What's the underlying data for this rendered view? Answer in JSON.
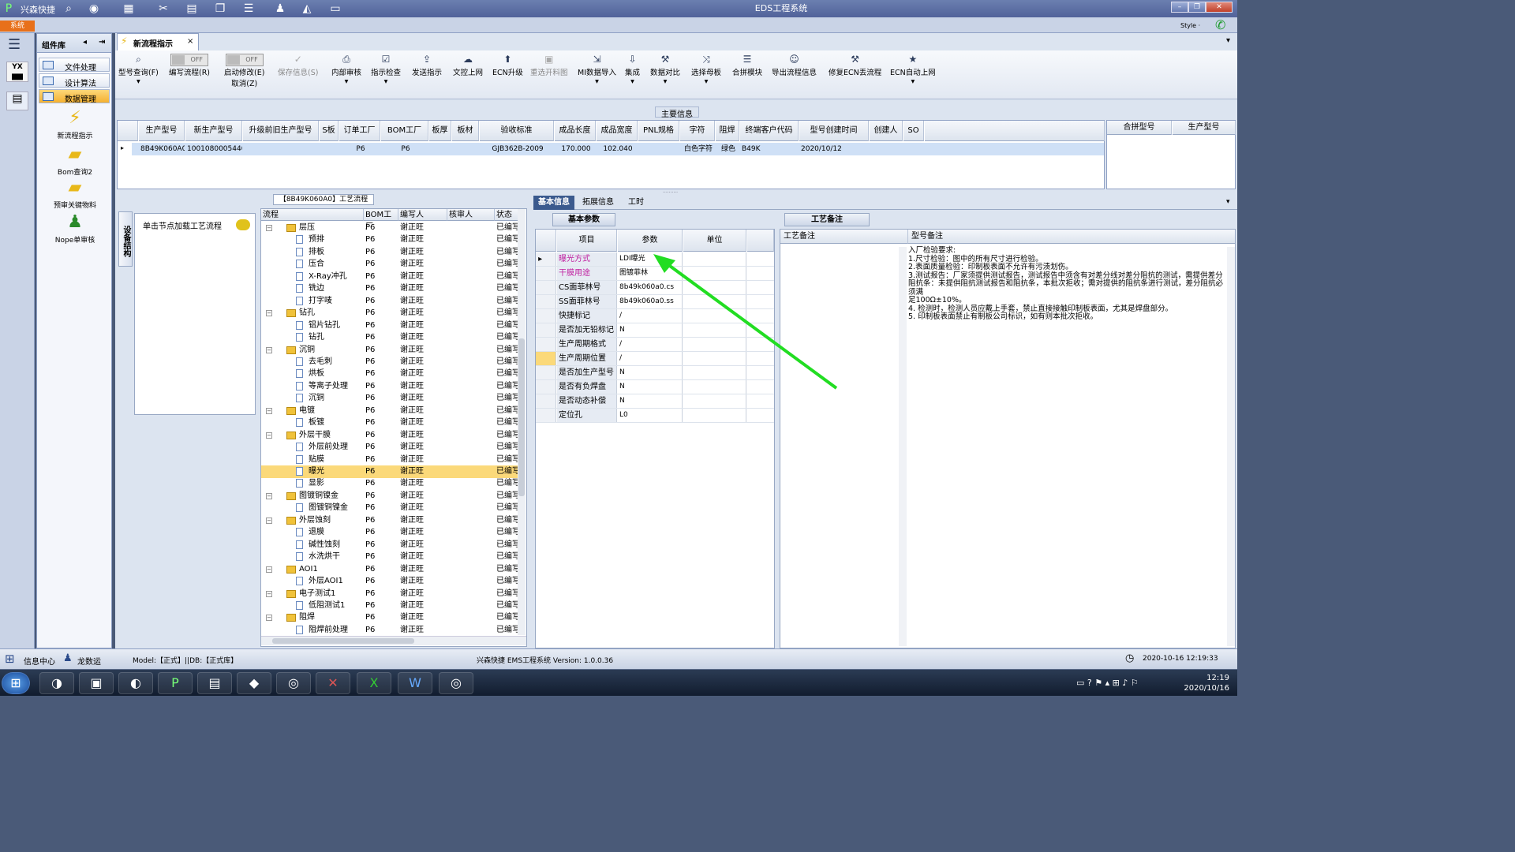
{
  "app": {
    "name": "兴森快捷",
    "window_title": "EDS工程系统",
    "style_label": "Style ·",
    "sys_tab": "系统"
  },
  "left_panel": {
    "header": "组件库",
    "items": [
      {
        "label": "文件处理"
      },
      {
        "label": "设计算法"
      },
      {
        "label": "数据管理"
      }
    ],
    "tools": [
      {
        "label": "新流程指示"
      },
      {
        "label": "Bom查询2"
      },
      {
        "label": "预审关键物料"
      },
      {
        "label": "Nope单审核"
      }
    ]
  },
  "doc_tab": {
    "label": "新流程指示"
  },
  "ribbon": {
    "buttons": [
      {
        "label": "型号查询(F)"
      },
      {
        "label": "编写流程(R)",
        "toggle": "OFF"
      },
      {
        "label": "启动修改(E)",
        "toggle": "OFF",
        "sub": "取消(Z)"
      },
      {
        "label": "保存信息(S)"
      },
      {
        "label": "内部审核"
      },
      {
        "label": "指示检查"
      },
      {
        "label": "发送指示"
      },
      {
        "label": "文控上网"
      },
      {
        "label": "ECN升级"
      },
      {
        "label": "重选开料图"
      },
      {
        "label": "MI数据导入"
      },
      {
        "label": "集成"
      },
      {
        "label": "数据对比"
      },
      {
        "label": "选择母板"
      },
      {
        "label": "合拼模块"
      },
      {
        "label": "导出流程信息"
      },
      {
        "label": "修复ECN丢流程"
      },
      {
        "label": "ECN自动上网"
      }
    ]
  },
  "main_info": {
    "title": "主要信息",
    "columns": [
      "生产型号",
      "新生产型号",
      "升级前旧生产型号",
      "S板",
      "订单工厂",
      "BOM工厂",
      "板厚",
      "板材",
      "验收标准",
      "成品长度",
      "成品宽度",
      "PNL规格",
      "字符",
      "阻焊",
      "终端客户代码",
      "型号创建时间",
      "创建人",
      "SO"
    ],
    "row": [
      "8B49K060A0",
      "10010800054405",
      "",
      "",
      "P6",
      "P6",
      "",
      "",
      "GJB362B-2009",
      "170.000",
      "102.040",
      "",
      "白色字符",
      "绿色",
      "B49K",
      "2020/10/12",
      "",
      ""
    ],
    "right_columns": [
      "合拼型号",
      "生产型号"
    ]
  },
  "flow": {
    "title": "【8B49K060A0】工艺流程",
    "side_tab": "设备结构",
    "load_hint": "单击节点加载工艺流程",
    "columns": [
      "流程",
      "BOM工厂",
      "编写人",
      "核审人",
      "状态"
    ],
    "rows": [
      {
        "name": "层压",
        "level": 0,
        "folder": true,
        "factory": "P6",
        "author": "谢正旺",
        "status": "已编写"
      },
      {
        "name": "预排",
        "level": 1,
        "factory": "P6",
        "author": "谢正旺",
        "status": "已编写"
      },
      {
        "name": "排板",
        "level": 1,
        "factory": "P6",
        "author": "谢正旺",
        "status": "已编写"
      },
      {
        "name": "压合",
        "level": 1,
        "factory": "P6",
        "author": "谢正旺",
        "status": "已编写"
      },
      {
        "name": "X-Ray冲孔",
        "level": 1,
        "factory": "P6",
        "author": "谢正旺",
        "status": "已编写"
      },
      {
        "name": "铣边",
        "level": 1,
        "factory": "P6",
        "author": "谢正旺",
        "status": "已编写"
      },
      {
        "name": "打字唛",
        "level": 1,
        "factory": "P6",
        "author": "谢正旺",
        "status": "已编写"
      },
      {
        "name": "钻孔",
        "level": 0,
        "folder": true,
        "factory": "P6",
        "author": "谢正旺",
        "status": "已编写"
      },
      {
        "name": "铝片钻孔",
        "level": 1,
        "factory": "P6",
        "author": "谢正旺",
        "status": "已编写"
      },
      {
        "name": "钻孔",
        "level": 1,
        "factory": "P6",
        "author": "谢正旺",
        "status": "已编写"
      },
      {
        "name": "沉铜",
        "level": 0,
        "folder": true,
        "factory": "P6",
        "author": "谢正旺",
        "status": "已编写"
      },
      {
        "name": "去毛刺",
        "level": 1,
        "factory": "P6",
        "author": "谢正旺",
        "status": "已编写"
      },
      {
        "name": "烘板",
        "level": 1,
        "factory": "P6",
        "author": "谢正旺",
        "status": "已编写"
      },
      {
        "name": "等离子处理",
        "level": 1,
        "factory": "P6",
        "author": "谢正旺",
        "status": "已编写"
      },
      {
        "name": "沉铜",
        "level": 1,
        "factory": "P6",
        "author": "谢正旺",
        "status": "已编写"
      },
      {
        "name": "电镀",
        "level": 0,
        "folder": true,
        "factory": "P6",
        "author": "谢正旺",
        "status": "已编写"
      },
      {
        "name": "板镀",
        "level": 1,
        "factory": "P6",
        "author": "谢正旺",
        "status": "已编写"
      },
      {
        "name": "外层干膜",
        "level": 0,
        "folder": true,
        "factory": "P6",
        "author": "谢正旺",
        "status": "已编写"
      },
      {
        "name": "外层前处理",
        "level": 1,
        "factory": "P6",
        "author": "谢正旺",
        "status": "已编写"
      },
      {
        "name": "贴膜",
        "level": 1,
        "factory": "P6",
        "author": "谢正旺",
        "status": "已编写"
      },
      {
        "name": "曝光",
        "level": 1,
        "factory": "P6",
        "author": "谢正旺",
        "status": "已编写",
        "selected": true
      },
      {
        "name": "显影",
        "level": 1,
        "factory": "P6",
        "author": "谢正旺",
        "status": "已编写"
      },
      {
        "name": "图镀铜镍金",
        "level": 0,
        "folder": true,
        "factory": "P6",
        "author": "谢正旺",
        "status": "已编写"
      },
      {
        "name": "图镀铜镍金",
        "level": 1,
        "factory": "P6",
        "author": "谢正旺",
        "status": "已编写"
      },
      {
        "name": "外层蚀刻",
        "level": 0,
        "folder": true,
        "factory": "P6",
        "author": "谢正旺",
        "status": "已编写"
      },
      {
        "name": "退膜",
        "level": 1,
        "factory": "P6",
        "author": "谢正旺",
        "status": "已编写"
      },
      {
        "name": "碱性蚀刻",
        "level": 1,
        "factory": "P6",
        "author": "谢正旺",
        "status": "已编写"
      },
      {
        "name": "水洗烘干",
        "level": 1,
        "factory": "P6",
        "author": "谢正旺",
        "status": "已编写"
      },
      {
        "name": "AOI1",
        "level": 0,
        "folder": true,
        "factory": "P6",
        "author": "谢正旺",
        "status": "已编写"
      },
      {
        "name": "外层AOI1",
        "level": 1,
        "factory": "P6",
        "author": "谢正旺",
        "status": "已编写"
      },
      {
        "name": "电子测试1",
        "level": 0,
        "folder": true,
        "factory": "P6",
        "author": "谢正旺",
        "status": "已编写"
      },
      {
        "name": "低阻测试1",
        "level": 1,
        "factory": "P6",
        "author": "谢正旺",
        "status": "已编写"
      },
      {
        "name": "阻焊",
        "level": 0,
        "folder": true,
        "factory": "P6",
        "author": "谢正旺",
        "status": "已编写"
      },
      {
        "name": "阻焊前处理",
        "level": 1,
        "factory": "P6",
        "author": "谢正旺",
        "status": "已编写"
      }
    ]
  },
  "info_tabs": [
    "基本信息",
    "拓展信息",
    "工时"
  ],
  "params": {
    "title": "基本参数",
    "columns": [
      "项目",
      "参数",
      "单位"
    ],
    "rows": [
      {
        "name": "曝光方式",
        "value": "LDI曝光",
        "highlight": "#c020a0"
      },
      {
        "name": "干膜用途",
        "value": "图镀菲林",
        "highlight": "#c020a0"
      },
      {
        "name": "CS面菲林号",
        "value": "8b49k060a0.cs"
      },
      {
        "name": "SS面菲林号",
        "value": "8b49k060a0.ss"
      },
      {
        "name": "快捷标记",
        "value": "/"
      },
      {
        "name": "是否加无铅标记",
        "value": "N"
      },
      {
        "name": "生产周期格式",
        "value": "/"
      },
      {
        "name": "生产周期位置",
        "value": "/"
      },
      {
        "name": "是否加生产型号",
        "value": "N"
      },
      {
        "name": "是否有负焊盘",
        "value": "N"
      },
      {
        "name": "是否动态补偿",
        "value": "N"
      },
      {
        "name": "定位孔",
        "value": "L0"
      }
    ]
  },
  "remarks": {
    "title": "工艺备注",
    "col1": "工艺备注",
    "col2": "型号备注",
    "lines": [
      "入厂检验要求:",
      "1.尺寸检验：图中的所有尺寸进行检验。",
      "2.表面质量检验：印制板表面不允许有污渍划伤。",
      "3.测试报告：厂家须提供测试报告，测试报告中须含有对差分线对差分阻抗的测试，需提供差分",
      "阻抗条：未提供阻抗测试报告和阻抗条，本批次拒收；需对提供的阻抗条进行测试，差分阻抗必须满",
      "足100Ω±10%。",
      "4. 检测时，检测人员应戴上手套，禁止直接接触印制板表面，尤其是焊盘部分。",
      "5. 印制板表面禁止有制板公司标识，如有则本批次拒收。"
    ]
  },
  "status": {
    "info": "信息中心",
    "user": "龙数运",
    "model": "Model:【正式】||DB:【正式库】",
    "version": "兴森快捷 EMS工程系统 Version: 1.0.0.36",
    "datetime": "2020-10-16 12:19:33"
  },
  "taskbar": {
    "time": "12:19",
    "date": "2020/10/16"
  },
  "colors": {
    "accent": "#3b5a8e",
    "selected_row": "#fbd97a",
    "annotation_arrow": "#22dd22"
  }
}
